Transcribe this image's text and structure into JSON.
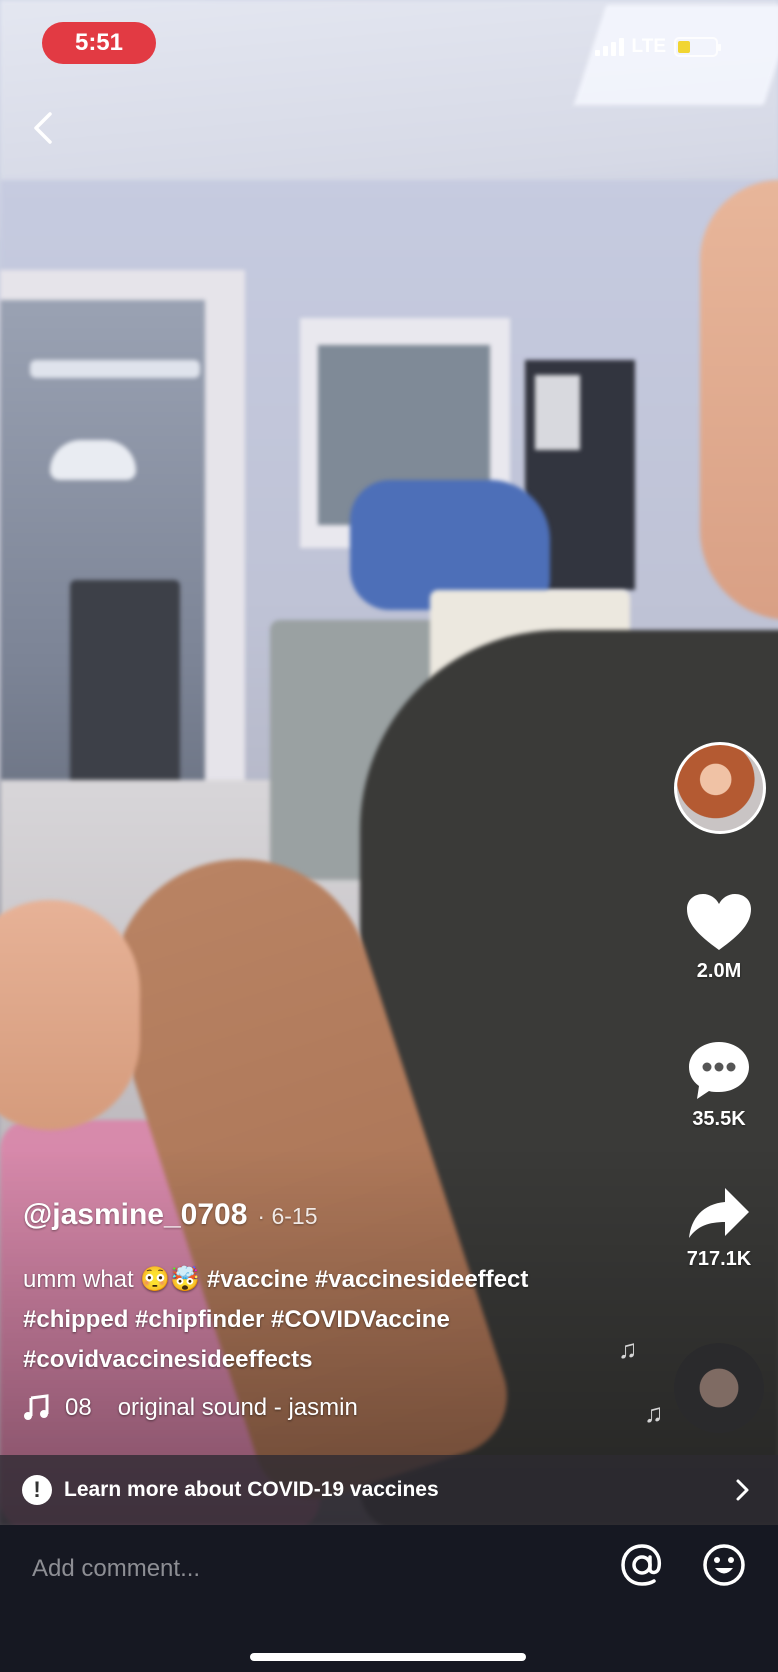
{
  "status_bar": {
    "time": "5:51",
    "network": "LTE",
    "time_pill_color": "#e23a43",
    "battery_color": "#f1d21d"
  },
  "navigation": {
    "back_icon": "chevron-left-icon"
  },
  "actions": {
    "likes": "2.0M",
    "comments": "35.5K",
    "shares": "717.1K",
    "like_icon": "heart-icon",
    "comment_icon": "speech-bubble-icon",
    "share_icon": "share-arrow-icon"
  },
  "post": {
    "username": "@jasmine_0708",
    "date": "· 6-15",
    "caption_prefix": "umm what 😳🤯",
    "hashtags_line1": "#vaccine #vaccinesideeffect",
    "hashtags_line2": "#chipped #chipfinder #COVIDVaccine",
    "hashtags_line3": "#covidvaccinesideeffects",
    "sound_prefix": "08",
    "sound": "original sound - jasmin"
  },
  "banner": {
    "text": "Learn more about COVID-19 vaccines",
    "icon": "info-icon",
    "chevron": "chevron-right-icon"
  },
  "comment_bar": {
    "placeholder": "Add comment...",
    "background": "#161822"
  }
}
